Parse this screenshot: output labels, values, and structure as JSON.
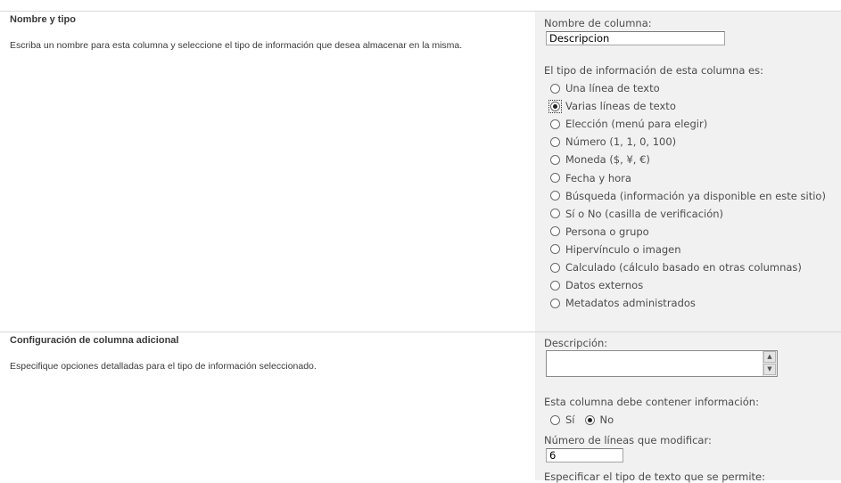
{
  "section1": {
    "title": "Nombre y tipo",
    "description": "Escriba un nombre para esta columna y seleccione el tipo de información que desea almacenar en la misma.",
    "column_name_label": "Nombre de columna:",
    "column_name_value": "Descripcion",
    "type_label": "El tipo de información de esta columna es:",
    "types": [
      {
        "label": "Una línea de texto",
        "checked": false
      },
      {
        "label": "Varias líneas de texto",
        "checked": true
      },
      {
        "label": "Elección (menú para elegir)",
        "checked": false
      },
      {
        "label": "Número (1, 1, 0, 100)",
        "checked": false
      },
      {
        "label": "Moneda ($, ¥, €)",
        "checked": false
      },
      {
        "label": "Fecha y hora",
        "checked": false
      },
      {
        "label": "Búsqueda (información ya disponible en este sitio)",
        "checked": false
      },
      {
        "label": "Sí o No (casilla de verificación)",
        "checked": false
      },
      {
        "label": "Persona o grupo",
        "checked": false
      },
      {
        "label": "Hipervínculo o imagen",
        "checked": false
      },
      {
        "label": "Calculado (cálculo basado en otras columnas)",
        "checked": false
      },
      {
        "label": "Datos externos",
        "checked": false
      },
      {
        "label": "Metadatos administrados",
        "checked": false
      }
    ]
  },
  "section2": {
    "title": "Configuración de columna adicional",
    "description": "Especifique opciones detalladas para el tipo de información seleccionado.",
    "description_label": "Descripción:",
    "description_value": "",
    "required_label": "Esta columna debe contener información:",
    "required_yes": "Sí",
    "required_no": "No",
    "required_value": "No",
    "lines_label": "Número de líneas que modificar:",
    "lines_value": "6",
    "text_type_label": "Especificar el tipo de texto que se permite:"
  }
}
